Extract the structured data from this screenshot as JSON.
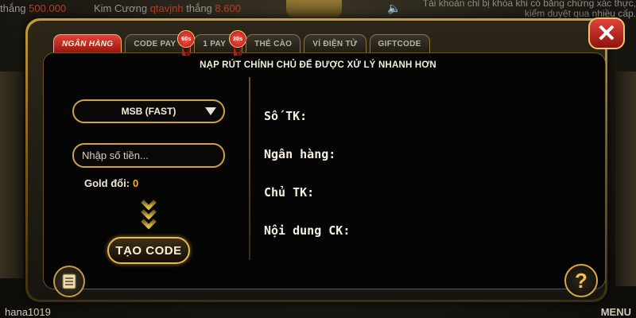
{
  "ticker": {
    "item1_prefix": "thắng",
    "item1_amount": "500.000",
    "item2_game": "Kim Cương",
    "item2_user": "qtavjnh",
    "item2_mid": "thắng",
    "item2_amount": "8.600",
    "notice": "Tài khoản chỉ bị khóa khi có bằng chứng xác thực, kiểm duyệt qua nhiều cấp."
  },
  "tabs": [
    {
      "label": "NGÂN HÀNG",
      "active": true
    },
    {
      "label": "CODE PAY",
      "badge": "60s"
    },
    {
      "label": "1 PAY",
      "badge": "30s"
    },
    {
      "label": "THẺ CÀO"
    },
    {
      "label": "VÍ ĐIỆN TỬ"
    },
    {
      "label": "GIFTCODE"
    }
  ],
  "headline": "NẠP RÚT CHÍNH CHỦ ĐỂ ĐƯỢC XỬ LÝ NHANH HƠN",
  "form": {
    "bank_selected": "MSB (FAST)",
    "amount_placeholder": "Nhập số tiền...",
    "gold_label": "Gold đổi:",
    "gold_value": "0",
    "submit_label": "TẠO CODE"
  },
  "info": {
    "account_label": "Số TK:",
    "bank_label": "Ngân hàng:",
    "owner_label": "Chủ TK:",
    "content_label": "Nội dung CK:"
  },
  "footer": {
    "username": "hana1019",
    "menu": "MENU"
  },
  "icons": {
    "close": "close-icon",
    "help": "help-icon",
    "doc": "document-icon"
  },
  "colors": {
    "accent_gold": "#cda24a",
    "active_tab_red": "#c41a14",
    "gold_value": "#f5b21c"
  }
}
